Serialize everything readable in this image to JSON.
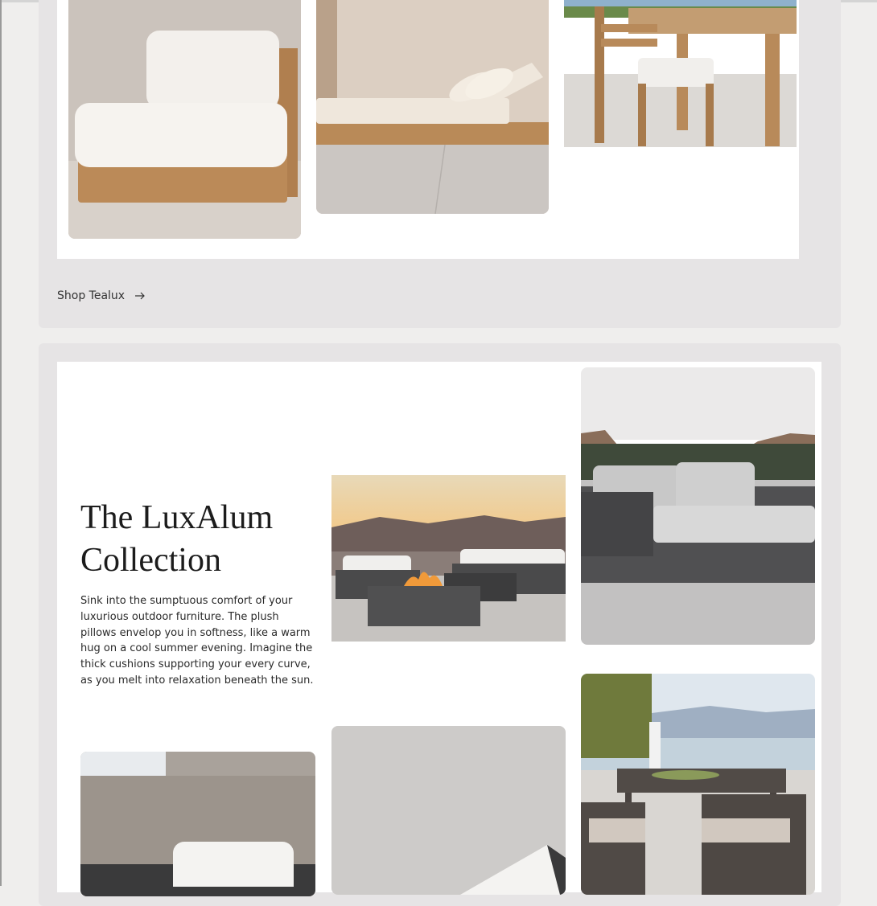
{
  "shop_link": {
    "label": "Shop Tealux"
  },
  "collection": {
    "title": "The LuxAlum Collection",
    "description": "Sink into the sumptuous comfort of your luxurious outdoor furniture. The plush pillows envelop you in softness, like a warm hug on a cool summer evening. Imagine the thick cushions supporting your every curve, as you melt into relaxation beneath the sun."
  },
  "colors": {
    "page_bg": "#efeeed",
    "section_bg": "#e6e4e5",
    "panel_bg": "#ffffff",
    "teak": "#b88a5a",
    "charcoal": "#4a4a4b"
  }
}
